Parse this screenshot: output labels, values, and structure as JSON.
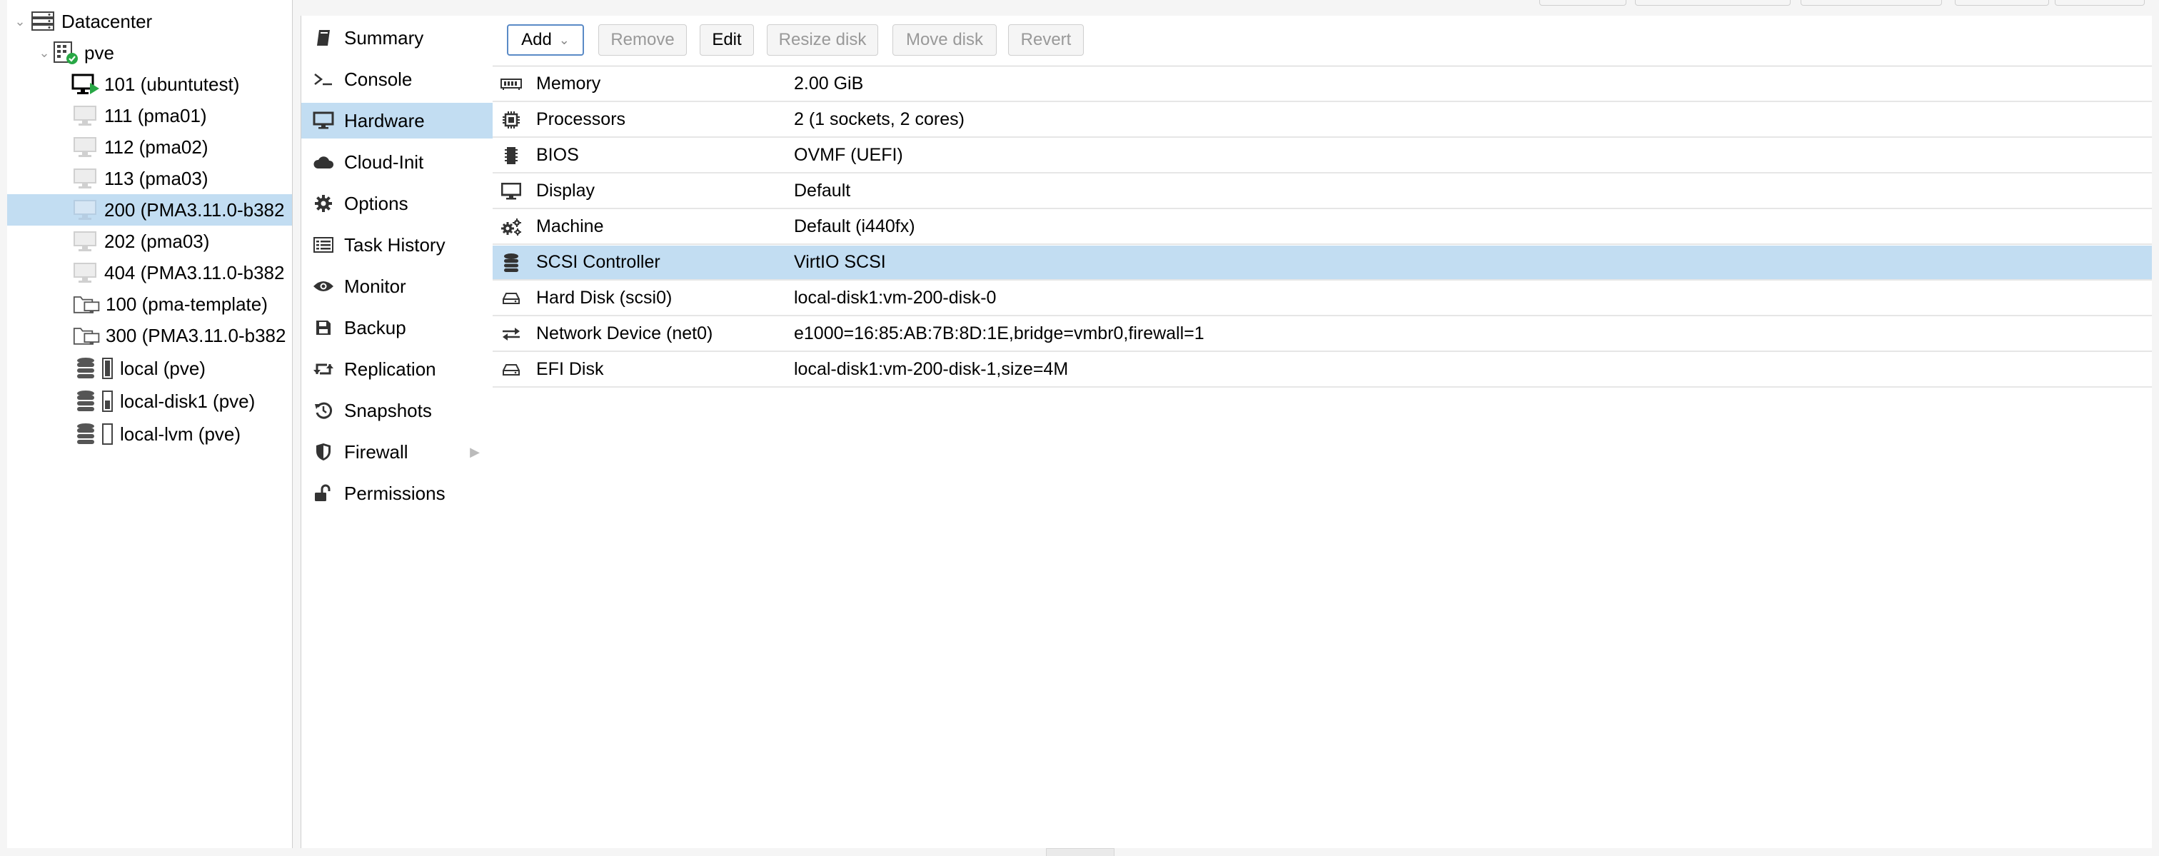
{
  "tree": {
    "datacenter": "Datacenter",
    "node": "pve",
    "items": [
      {
        "label": "101 (ubuntutest)",
        "kind": "vm-running"
      },
      {
        "label": "111 (pma01)",
        "kind": "vm"
      },
      {
        "label": "112 (pma02)",
        "kind": "vm"
      },
      {
        "label": "113 (pma03)",
        "kind": "vm"
      },
      {
        "label": "200 (PMA3.11.0-b382",
        "kind": "vm",
        "selected": true
      },
      {
        "label": "202 (pma03)",
        "kind": "vm"
      },
      {
        "label": "404 (PMA3.11.0-b382",
        "kind": "vm"
      },
      {
        "label": "100 (pma-template)",
        "kind": "template"
      },
      {
        "label": "300 (PMA3.11.0-b382",
        "kind": "template"
      },
      {
        "label": "local (pve)",
        "kind": "storage"
      },
      {
        "label": "local-disk1 (pve)",
        "kind": "storage"
      },
      {
        "label": "local-lvm (pve)",
        "kind": "storage"
      }
    ]
  },
  "nav": {
    "items": [
      {
        "label": "Summary",
        "icon": "book-icon"
      },
      {
        "label": "Console",
        "icon": "terminal-icon"
      },
      {
        "label": "Hardware",
        "icon": "desktop-icon",
        "selected": true
      },
      {
        "label": "Cloud-Init",
        "icon": "cloud-icon"
      },
      {
        "label": "Options",
        "icon": "gear-icon"
      },
      {
        "label": "Task History",
        "icon": "list-icon"
      },
      {
        "label": "Monitor",
        "icon": "eye-icon"
      },
      {
        "label": "Backup",
        "icon": "floppy-icon"
      },
      {
        "label": "Replication",
        "icon": "retweet-icon"
      },
      {
        "label": "Snapshots",
        "icon": "history-icon"
      },
      {
        "label": "Firewall",
        "icon": "shield-icon",
        "has_submenu": true
      },
      {
        "label": "Permissions",
        "icon": "unlock-icon"
      }
    ]
  },
  "toolbar": {
    "add": "Add",
    "remove": "Remove",
    "edit": "Edit",
    "resize": "Resize disk",
    "move": "Move disk",
    "revert": "Revert"
  },
  "hardware": {
    "rows": [
      {
        "name": "Memory",
        "value": "2.00 GiB",
        "icon": "memory-icon"
      },
      {
        "name": "Processors",
        "value": "2 (1 sockets, 2 cores)",
        "icon": "cpu-icon"
      },
      {
        "name": "BIOS",
        "value": "OVMF (UEFI)",
        "icon": "microchip-icon"
      },
      {
        "name": "Display",
        "value": "Default",
        "icon": "monitor-icon"
      },
      {
        "name": "Machine",
        "value": "Default (i440fx)",
        "icon": "cogs-icon"
      },
      {
        "name": "SCSI Controller",
        "value": "VirtIO SCSI",
        "icon": "database-icon",
        "selected": true
      },
      {
        "name": "Hard Disk (scsi0)",
        "value": "local-disk1:vm-200-disk-0",
        "icon": "hdd-icon"
      },
      {
        "name": "Network Device (net0)",
        "value": "e1000=16:85:AB:7B:8D:1E,bridge=vmbr0,firewall=1",
        "icon": "exchange-icon"
      },
      {
        "name": "EFI Disk",
        "value": "local-disk1:vm-200-disk-1,size=4M",
        "icon": "hdd-icon"
      }
    ]
  },
  "colors": {
    "selection": "#c2ddf2",
    "running": "#28a745",
    "border": "#cfcfcf"
  }
}
